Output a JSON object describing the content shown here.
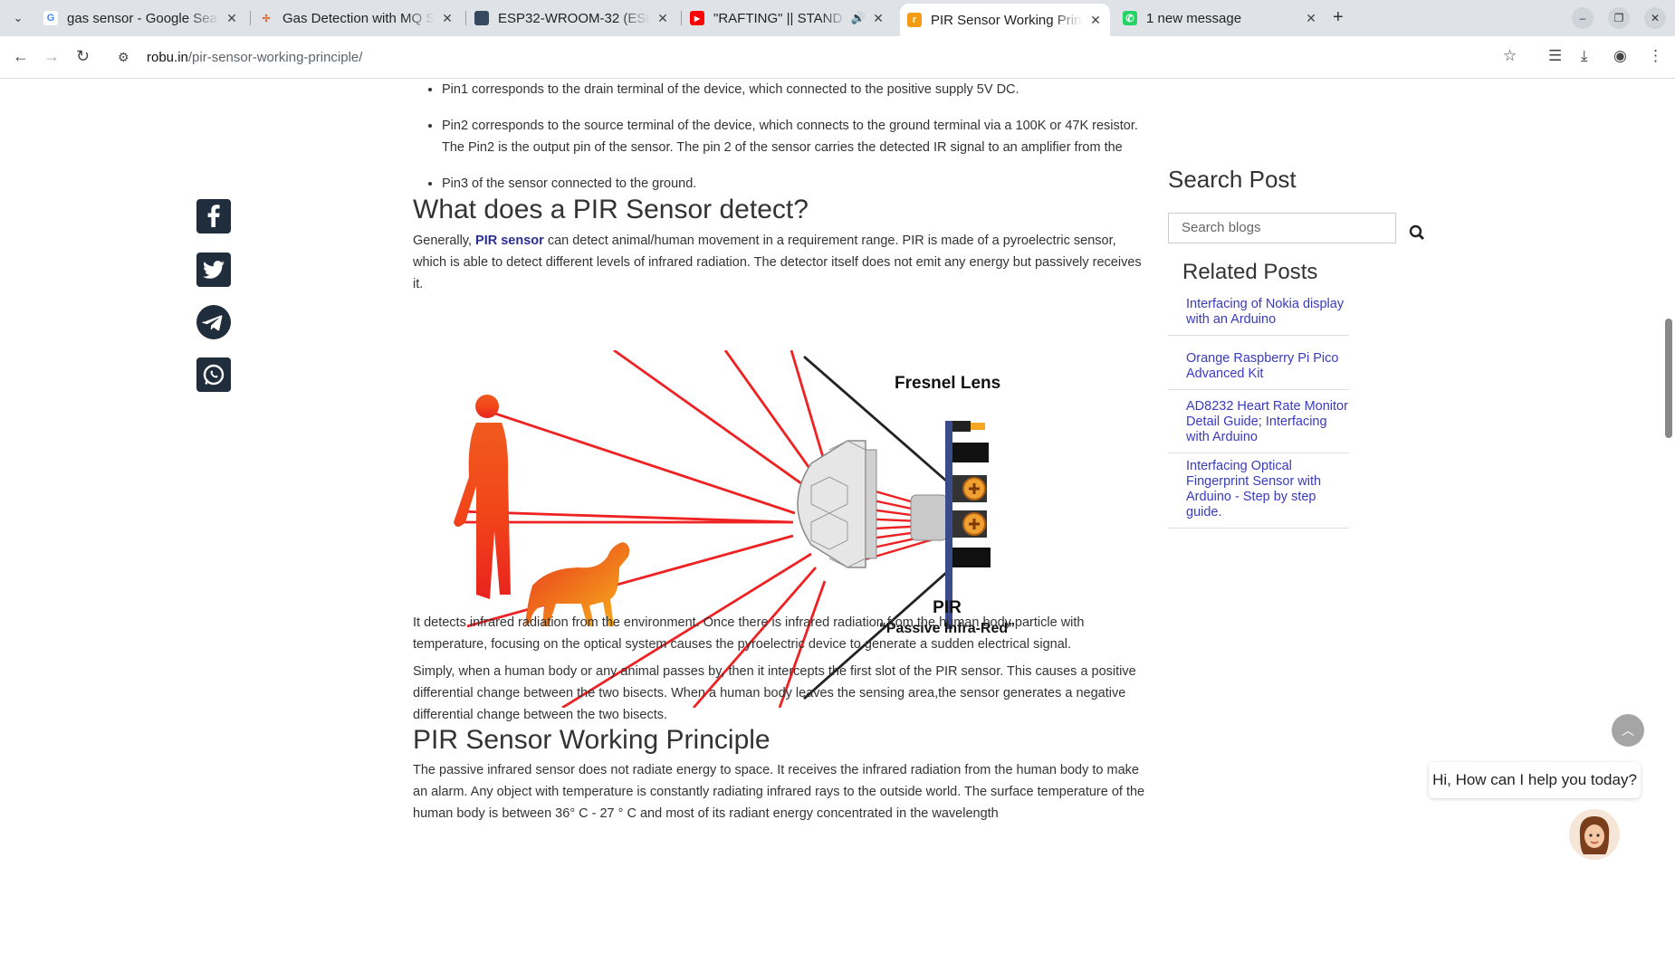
{
  "browser": {
    "tabs": [
      {
        "title": "gas sensor - Google Sear",
        "favicon": "google-icon"
      },
      {
        "title": "Gas Detection with MQ S",
        "favicon": "pinwheel-icon"
      },
      {
        "title": "ESP32-WROOM-32 (ESP-",
        "favicon": "board-icon"
      },
      {
        "title": "\"RAFTING\" || STAND U",
        "favicon": "youtube-icon"
      },
      {
        "title": "PIR Sensor Working Princ",
        "favicon": "robu-icon"
      },
      {
        "title": "1 new message",
        "favicon": "whatsapp-icon"
      }
    ],
    "url_host": "robu.in",
    "url_path": "/pir-sensor-working-principle/"
  },
  "article": {
    "pins": [
      "Pin1 corresponds to the drain terminal of the device, which connected to the positive supply 5V DC.",
      "Pin2 corresponds to the source terminal of the device, which connects to the ground terminal via a 100K or 47K resistor. The Pin2 is the output pin of the sensor. The pin 2 of the sensor carries the detected IR signal to an amplifier from the",
      "Pin3 of the sensor connected to the ground."
    ],
    "h_detect": "What does a PIR Sensor detect?",
    "p_detect_pre": "Generally, ",
    "p_detect_link": "PIR sensor",
    "p_detect_post": " can detect animal/human movement in a requirement range. PIR is made of a pyroelectric sensor, which is able to detect different levels of infrared radiation.  The detector itself does not emit any energy but passively receives it.",
    "figure": {
      "lens_label": "Fresnel Lens",
      "pir_label": "PIR",
      "pir_sub": "“Passive Infra-Red”"
    },
    "p_it_detects": "It detects infrared radiation from the environment. Once there is infrared radiation from the human body particle with temperature, focusing on the optical system causes the pyroelectric device to generate a sudden electrical signal.",
    "p_simply": "Simply, when a human body or any animal passes by, then it intercepts the first slot of the PIR sensor. This causes a positive differential change between the two bisects. When a human body leaves the sensing area,the sensor generates a negative differential change between the two bisects.",
    "h_principle": "PIR Sensor Working Principle",
    "p_principle": "The passive infrared sensor does not radiate energy to space. It receives the  infrared radiation from the human body to make an alarm. Any object with temperature is constantly radiating infrared rays to the outside world. The surface temperature of the human body is between 36° C - 27 ° C and most of its radiant energy concentrated in the wavelength"
  },
  "sidebar": {
    "search_title": "Search Post",
    "search_placeholder": "Search blogs",
    "related_title": "Related Posts",
    "related": [
      "Interfacing of Nokia display with an Arduino",
      "Orange Raspberry Pi Pico Advanced Kit",
      "AD8232 Heart Rate Monitor Detail Guide; Interfacing with Arduino",
      "Interfacing Optical Fingerprint Sensor with Arduino - Step by step guide."
    ]
  },
  "chat": {
    "greeting": "Hi, How can I help you today?"
  },
  "colors": {
    "link": "#2b2d8f",
    "related": "#3a3ac0",
    "ray": "#ee2222"
  }
}
